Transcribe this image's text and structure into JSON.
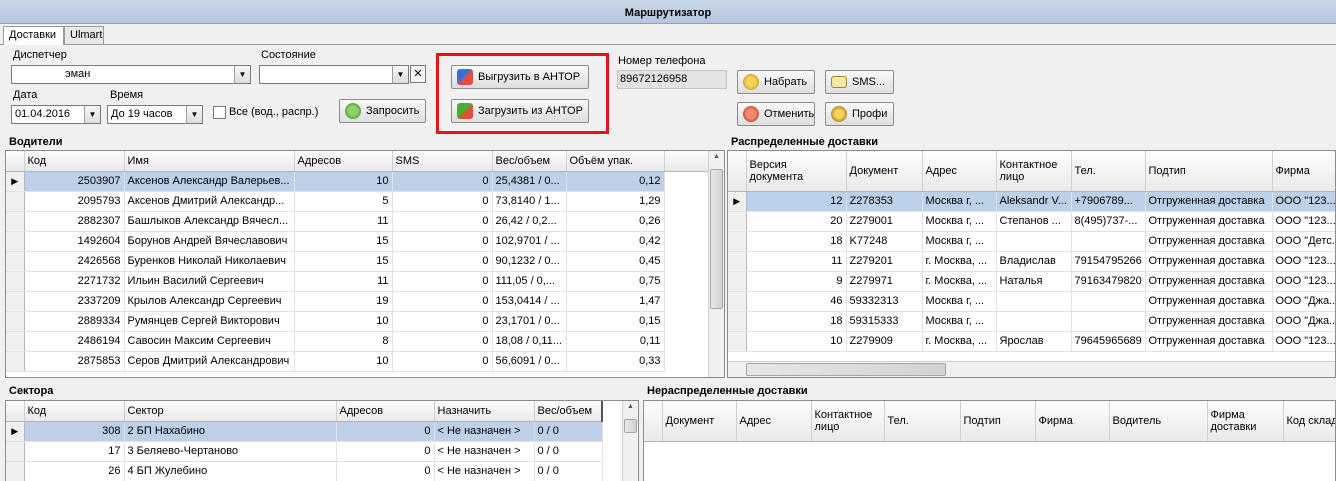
{
  "window": {
    "title": "Маршрутизатор"
  },
  "tabs": [
    "Доставки",
    "Ulmart"
  ],
  "form": {
    "dispatcher_label": "Диспетчер",
    "dispatcher_value": "эман",
    "state_label": "Состояние",
    "state_value": "",
    "date_label": "Дата",
    "date_value": "01.04.2016",
    "time_label": "Время",
    "time_value": "До 19 часов",
    "all_label": "Все (вод., распр.)",
    "request_button": "Запросить",
    "export_button": "Выгрузить в АНТОР",
    "import_button": "Загрузить из АНТОР",
    "phone_label": "Номер телефона",
    "phone_value": "89672126958",
    "dial_button": "Набрать",
    "sms_button": "SMS...",
    "cancel_button": "Отменить",
    "profi_button": "Профи"
  },
  "drivers": {
    "title": "Водители",
    "columns": [
      "Код",
      "Имя",
      "Адресов",
      "SMS",
      "Вес/объем",
      "Объём упак."
    ],
    "rows": [
      [
        "2503907",
        "Аксенов Александр Валерьев...",
        "10",
        "0",
        "25,4381 / 0...",
        "0,12"
      ],
      [
        "2095793",
        "Аксенов Дмитрий Александр...",
        "5",
        "0",
        "73,8140 / 1...",
        "1,29"
      ],
      [
        "2882307",
        "Башлыков Александр Вячесл...",
        "11",
        "0",
        "26,42 / 0,2...",
        "0,26"
      ],
      [
        "1492604",
        "Борунов Андрей Вячеславович",
        "15",
        "0",
        "102,9701 / ...",
        "0,42"
      ],
      [
        "2426568",
        "Буренков Николай Николаевич",
        "15",
        "0",
        "90,1232 / 0...",
        "0,45"
      ],
      [
        "2271732",
        "Ильин Василий Сергеевич",
        "11",
        "0",
        "111,05 / 0,...",
        "0,75"
      ],
      [
        "2337209",
        "Крылов Александр Сергеевич",
        "19",
        "0",
        "153,0414 / ...",
        "1,47"
      ],
      [
        "2889334",
        "Румянцев Сергей Викторович",
        "10",
        "0",
        "23,1701 / 0...",
        "0,15"
      ],
      [
        "2486194",
        "Савосин Максим Сергеевич",
        "8",
        "0",
        "18,08 / 0,11...",
        "0,11"
      ],
      [
        "2875853",
        "Серов  Дмитрий Александрович",
        "10",
        "0",
        "56,6091 / 0...",
        "0,33"
      ]
    ]
  },
  "distributed": {
    "title": "Распределенные доставки",
    "columns": [
      "Версия документа",
      "Документ",
      "Адрес",
      "Контактное лицо",
      "Тел.",
      "Подтип",
      "Фирма"
    ],
    "rows": [
      [
        "12",
        "Z278353",
        "Москва г, ...",
        "Aleksandr V...",
        "+7906789...",
        "Отгруженная доставка",
        "ООО \"123..."
      ],
      [
        "20",
        "Z279001",
        "Москва г, ...",
        "Степанов ...",
        "8(495)737-...",
        "Отгруженная доставка",
        "ООО \"123..."
      ],
      [
        "18",
        "K77248",
        "Москва г, ...",
        "",
        "",
        "Отгруженная доставка",
        "ООО \"Детс..."
      ],
      [
        "11",
        "Z279201",
        "г. Москва, ...",
        "Владислав",
        "79154795266",
        "Отгруженная доставка",
        "ООО \"123..."
      ],
      [
        "9",
        "Z279971",
        "г. Москва, ...",
        "Наталья",
        "79163479820",
        "Отгруженная доставка",
        "ООО \"123..."
      ],
      [
        "46",
        "59332313",
        "Москва г, ...",
        "",
        "",
        "Отгруженная доставка",
        "ООО \"Джа..."
      ],
      [
        "18",
        "59315333",
        "Москва г, ...",
        "",
        "",
        "Отгруженная доставка",
        "ООО \"Джа..."
      ],
      [
        "10",
        "Z279909",
        "г. Москва, ...",
        "Ярослав",
        "79645965689",
        "Отгруженная доставка",
        "ООО \"123..."
      ]
    ]
  },
  "sectors": {
    "title": "Сектора",
    "columns": [
      "Код",
      "Сектор",
      "Адресов",
      "Назначить",
      "Вес/объем"
    ],
    "rows": [
      [
        "308",
        "2 БП  Нахабино",
        "0",
        "< Не назначен >",
        "0 / 0"
      ],
      [
        "17",
        "3 Беляево-Чертаново",
        "0",
        "< Не назначен >",
        "0 / 0"
      ],
      [
        "26",
        "4 БП Жулебино",
        "0",
        "< Не назначен >",
        "0 / 0"
      ]
    ]
  },
  "undistributed": {
    "title": "Нераспределенные доставки",
    "columns": [
      "Документ",
      "Адрес",
      "Контактное лицо",
      "Тел.",
      "Подтип",
      "Фирма",
      "Водитель",
      "Фирма доставки",
      "Код склад"
    ]
  },
  "colors": {
    "highlight": "#bcd0ea",
    "annotation": "#e0161b",
    "titlebar": "#c9d6e8"
  }
}
